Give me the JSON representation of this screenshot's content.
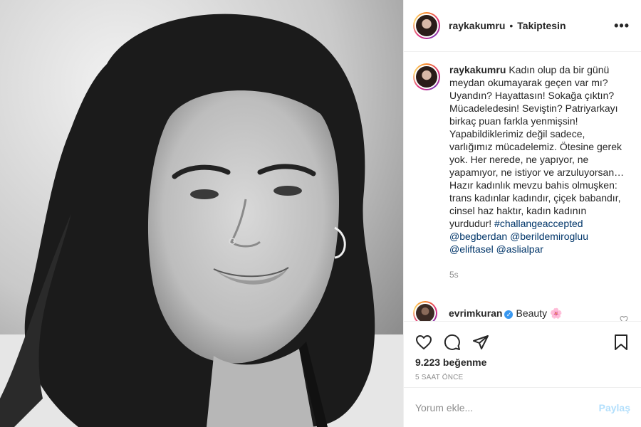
{
  "post": {
    "author": "raykakumru",
    "separator": "•",
    "follow_status": "Takiptesin",
    "more_label": "•••"
  },
  "caption": {
    "username": "raykakumru",
    "text": "Kadın olup da bir günü meydan okumayarak geçen var mı? Uyandın? Hayattasın! Sokağa çıktın? Mücadeledesin! Seviştin? Patriyarkayı birkaç puan farkla yenmişsin! Yapabildiklerimiz değil sadece, varlığımız mücadelemiz. Ötesine gerek yok. Her nerede, ne yapıyor, ne yapamıyor, ne istiyor ve arzuluyorsan… Hazır kadınlık mevzu bahis olmuşken: trans kadınlar kadındır, çiçek babandır, cinsel haz haktır, kadın kadının yurdudur!",
    "hashtag": "#challangeaccepted",
    "mentions": [
      "@begberdan",
      "@berildemirogluu",
      "@eliftasel",
      "@aslialpar"
    ],
    "time": "5s"
  },
  "comment": {
    "username": "evrimkuran",
    "verified_mark": "✓",
    "text": "Beauty",
    "emoji": "🌸"
  },
  "stats": {
    "likes": "9.223 beğenme",
    "posted_ago": "5 SAAT ÖNCE"
  },
  "composer": {
    "placeholder": "Yorum ekle...",
    "post_label": "Paylaş"
  },
  "icons": {
    "like": "heart-icon",
    "comment": "comment-icon",
    "share": "share-icon",
    "save": "bookmark-icon",
    "comment_like": "heart-small-icon"
  }
}
